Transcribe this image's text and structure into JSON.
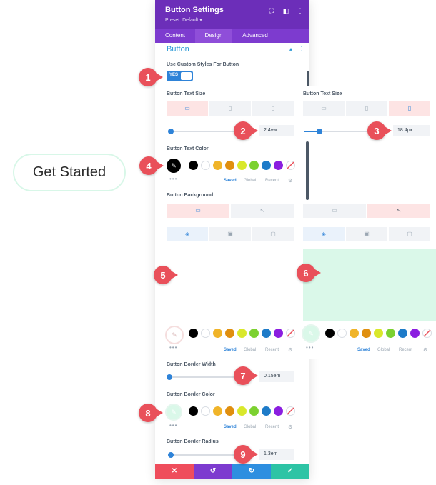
{
  "demo_button": {
    "label": "Get Started"
  },
  "header": {
    "title": "Button Settings",
    "preset": "Preset: Default ▾"
  },
  "tabs": [
    {
      "label": "Content"
    },
    {
      "label": "Design"
    },
    {
      "label": "Advanced"
    }
  ],
  "section": {
    "title": "Button"
  },
  "custom_styles": {
    "label": "Use Custom Styles For Button",
    "toggle": "YES"
  },
  "text_size": {
    "label": "Button Text Size",
    "value": "2.4vw",
    "phone_value": "18.4px"
  },
  "text_color": {
    "label": "Button Text Color"
  },
  "background": {
    "label": "Button Background"
  },
  "border_width": {
    "label": "Button Border Width",
    "value": "0.15em"
  },
  "border_color": {
    "label": "Button Border Color"
  },
  "border_radius": {
    "label": "Button Border Radius",
    "value": "1.3em"
  },
  "palette": {
    "tabs": {
      "saved": "Saved",
      "global": "Global",
      "recent": "Recent"
    },
    "colors": [
      "#000000",
      "#ffffff",
      "#f0b429",
      "#e08f0f",
      "#d9e82b",
      "#7cd130",
      "#1e7bc8",
      "#8b1ee0"
    ]
  },
  "callouts": [
    "1",
    "2",
    "3",
    "4",
    "5",
    "6",
    "7",
    "8",
    "9"
  ],
  "colors": {
    "purple_header": "#6c2eb9",
    "accent_blue": "#2e83d8",
    "mint": "#daf8e9",
    "callout_red": "#e9505a"
  }
}
